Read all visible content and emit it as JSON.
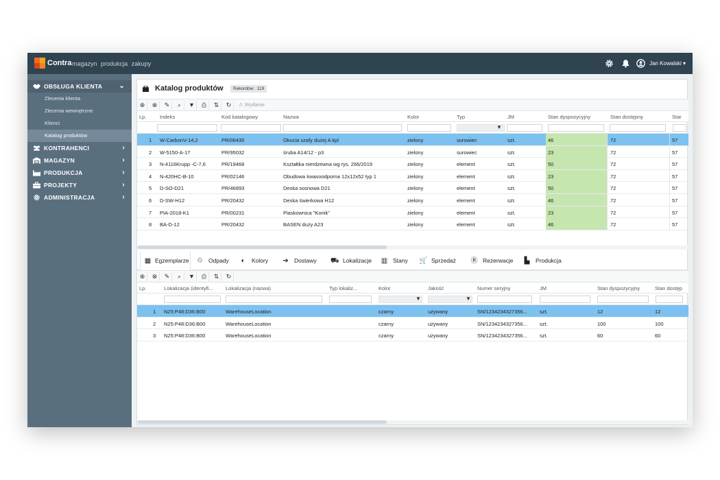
{
  "topbar": {
    "brand": "Contra",
    "menu": [
      "magazyn",
      "produkcja",
      "zakupy"
    ],
    "user_name": "Jan Kowalski"
  },
  "sidebar": {
    "groups": [
      {
        "label": "OBSŁUGA KLIENTA",
        "icon": "handshake-icon"
      },
      {
        "label": "KONTRAHENCI",
        "icon": "users-icon"
      },
      {
        "label": "MAGAZYN",
        "icon": "warehouse-icon"
      },
      {
        "label": "PRODUKCJA",
        "icon": "factory-icon"
      },
      {
        "label": "PROJEKTY",
        "icon": "briefcase-icon"
      },
      {
        "label": "ADMINISTRACJA",
        "icon": "gear-icon"
      }
    ],
    "sub_items": [
      "Zlecenia klienta",
      "Zlecenia wewnętrzne",
      "Klienci",
      "Katalog produktów"
    ]
  },
  "panel": {
    "title": "Katalog produktów",
    "records_label": "Rekordów:",
    "records_count": "119",
    "wydanie_label": "Wydanie"
  },
  "products": {
    "columns": [
      "Lp.",
      "Indeks",
      "Kod katalogowy",
      "Nazwa",
      "Kolor",
      "Typ",
      "JM",
      "Stan dyspozycyjny",
      "Stan dostępny",
      "Star"
    ],
    "rows": [
      [
        "1",
        "W-CarbonV-14,2",
        "PR/06435",
        "Okucia szafy dużej A kpl",
        "zielony",
        "surowiec",
        "szt.",
        "46",
        "72",
        "57"
      ],
      [
        "2",
        "W-5150-A-17",
        "PR/95032",
        "śruba A14/12 - p3",
        "zielony",
        "surowiec",
        "szt.",
        "23",
        "72",
        "57"
      ],
      [
        "3",
        "N-4116Krupp -C-7,6",
        "PR/19468",
        "Kształtka nierdzewna wg rys. 266/2019",
        "zielony",
        "element",
        "szt.",
        "50",
        "72",
        "57"
      ],
      [
        "4",
        "N-420HC-B-10",
        "PR/02146",
        "Obudowa kwasoodporna 12x12x52 typ 1",
        "zielony",
        "element",
        "szt.",
        "23",
        "72",
        "57"
      ],
      [
        "5",
        "D-SO-D21",
        "PR/46893",
        "Deska sosnowa D21",
        "zielony",
        "element",
        "szt.",
        "50",
        "72",
        "57"
      ],
      [
        "6",
        "D-SW-H12",
        "PR/20432",
        "Deska świerkowa H12",
        "zielony",
        "element",
        "szt.",
        "46",
        "72",
        "57"
      ],
      [
        "7",
        "PIA-2018-K1",
        "PR/00231",
        "Piaskownica \"Konik\"",
        "zielony",
        "element",
        "szt.",
        "23",
        "72",
        "57"
      ],
      [
        "8",
        "BA-D-12",
        "PR/20432",
        "BASEN duży A23",
        "zielony",
        "element",
        "szt.",
        "46",
        "72",
        "57"
      ]
    ]
  },
  "tabs": [
    {
      "label": "Egzemplarze",
      "icon": "pallet-icon"
    },
    {
      "label": "Odpady",
      "icon": "recycle-icon"
    },
    {
      "label": "Kolory",
      "icon": "contrast-icon"
    },
    {
      "label": "Dostawy",
      "icon": "sign-in-icon"
    },
    {
      "label": "Lokalizacje",
      "icon": "dolly-icon"
    },
    {
      "label": "Stany",
      "icon": "chart-icon"
    },
    {
      "label": "Sprzedaż",
      "icon": "cart-icon"
    },
    {
      "label": "Rezerwacje",
      "icon": "registered-icon"
    },
    {
      "label": "Produkcja",
      "icon": "factory-icon"
    }
  ],
  "items": {
    "columns": [
      "Lp.",
      "Lokalizacja (identyfi...",
      "Lokalizacja (nazwa)",
      "Typ lokaliz...",
      "Kolor",
      "Jakość",
      "Numer seryjny",
      "JM",
      "Stan dyspozycyjny",
      "Stan dostęp"
    ],
    "rows": [
      [
        "1",
        "N25:P48:D36:B00",
        "WarehouseLocation",
        "",
        "czarny",
        "używany",
        "SN/1234234327356...",
        "szt.",
        "12",
        "12"
      ],
      [
        "2",
        "N25:P48:D36:B00",
        "WarehouseLocation",
        "",
        "czarny",
        "używany",
        "SN/1234234327356...",
        "szt.",
        "100",
        "100"
      ],
      [
        "3",
        "N25:P48:D36:B00",
        "WarehouseLocation",
        "",
        "czarny",
        "używany",
        "SN/1234234327356...",
        "szt.",
        "60",
        "60"
      ]
    ]
  },
  "colors": {
    "topbar": "#2f4350",
    "sidebar": "#5a6f7e",
    "selected_row": "#7cc1f0",
    "stock_highlight": "#c6e6b0"
  }
}
